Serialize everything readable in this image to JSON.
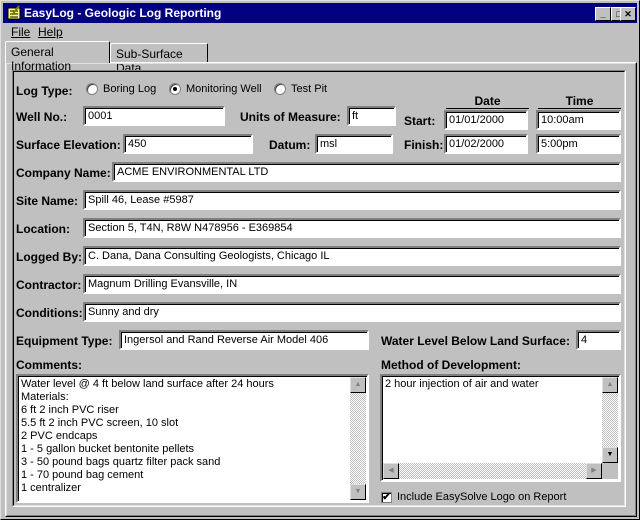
{
  "window": {
    "title": "EasyLog - Geologic Log Reporting",
    "controls": {
      "minimize": "_",
      "maximize": "□",
      "close": "✕"
    }
  },
  "menu": {
    "file": "File",
    "help": "Help"
  },
  "tabs": [
    {
      "label": "General Information",
      "active": true
    },
    {
      "label": "Sub-Surface Data",
      "active": false
    }
  ],
  "form": {
    "log_type": {
      "label": "Log Type:",
      "options": [
        {
          "label": "Boring Log",
          "selected": false
        },
        {
          "label": "Monitoring Well",
          "selected": true
        },
        {
          "label": "Test Pit",
          "selected": false
        }
      ]
    },
    "well_no": {
      "label": "Well No.:",
      "value": "0001"
    },
    "units": {
      "label": "Units of Measure:",
      "value": "ft"
    },
    "surface_elevation": {
      "label": "Surface Elevation:",
      "value": "450"
    },
    "datum": {
      "label": "Datum:",
      "value": "msl"
    },
    "date_header": "Date",
    "time_header": "Time",
    "start": {
      "label": "Start:",
      "date": "01/01/2000",
      "time": "10:00am"
    },
    "finish": {
      "label": "Finish:",
      "date": "01/02/2000",
      "time": "5:00pm"
    },
    "company_name": {
      "label": "Company Name:",
      "value": "ACME ENVIRONMENTAL LTD"
    },
    "site_name": {
      "label": "Site Name:",
      "value": "Spill 46,  Lease #5987"
    },
    "location": {
      "label": "Location:",
      "value": "Section 5, T4N, R8W        N478956 - E369854"
    },
    "logged_by": {
      "label": "Logged By:",
      "value": "C. Dana,  Dana Consulting Geologists, Chicago IL"
    },
    "contractor": {
      "label": "Contractor:",
      "value": "Magnum Drilling    Evansville, IN"
    },
    "conditions": {
      "label": "Conditions:",
      "value": "Sunny and dry"
    },
    "equipment_type": {
      "label": "Equipment Type:",
      "value": "Ingersol and Rand Reverse Air  Model 406"
    },
    "water_level": {
      "label": "Water Level Below Land Surface:",
      "value": "4"
    },
    "comments": {
      "label": "Comments:",
      "value": "Water level @ 4 ft below land surface after 24 hours\nMaterials:\n6 ft 2 inch PVC riser\n5.5 ft 2 inch PVC screen, 10 slot\n2 PVC endcaps\n1 - 5 gallon bucket bentonite pellets\n3 - 50 pound bags quartz filter pack sand\n1 - 70 pound bag cement\n1 centralizer"
    },
    "method_of_development": {
      "label": "Method of Development:",
      "value": "2 hour injection of air and water"
    },
    "include_logo": {
      "label": "Include EasySolve Logo on Report",
      "checked": true,
      "mark": "✔"
    }
  },
  "scroll_glyphs": {
    "up": "▲",
    "down": "▼",
    "left": "◀",
    "right": "▶"
  }
}
